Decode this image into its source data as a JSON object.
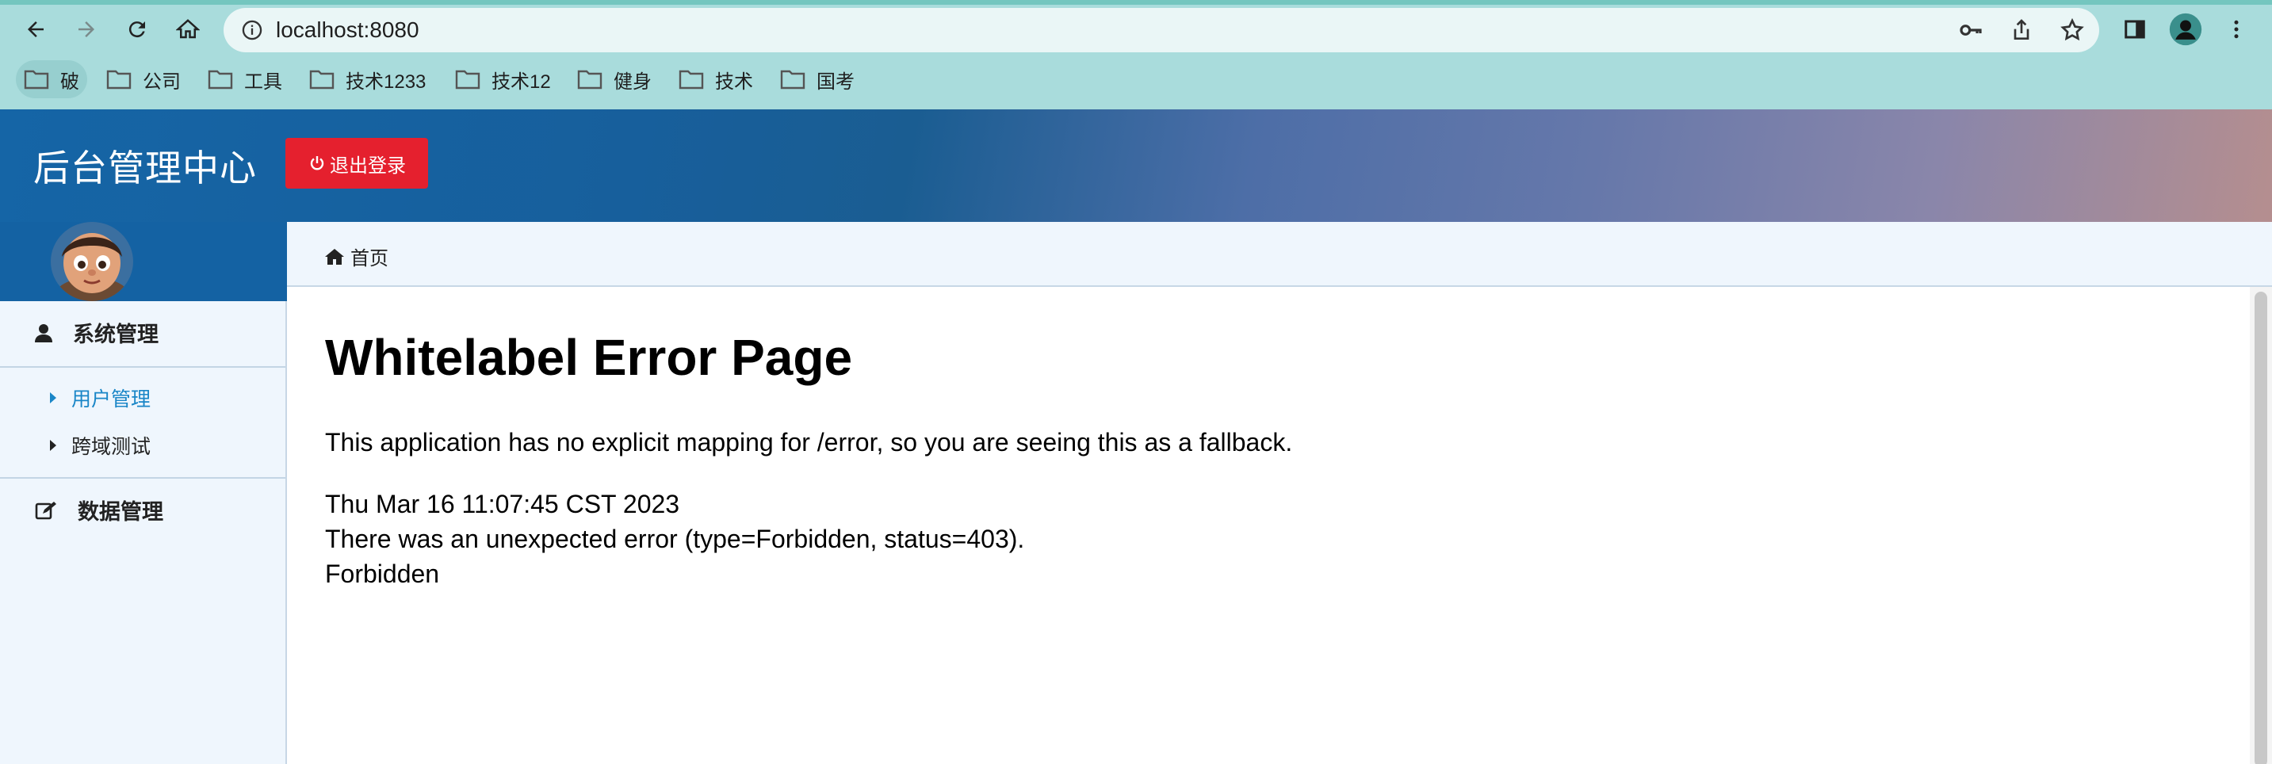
{
  "browser": {
    "url": "localhost:8080",
    "bookmarks": [
      {
        "label": "破",
        "icon": "folder-icon"
      },
      {
        "label": "公司",
        "icon": "folder-icon"
      },
      {
        "label": "工具",
        "icon": "folder-icon"
      },
      {
        "label": "技术1233",
        "icon": "folder-icon"
      },
      {
        "label": "技术12",
        "icon": "folder-icon"
      },
      {
        "label": "健身",
        "icon": "folder-icon"
      },
      {
        "label": "技术",
        "icon": "folder-icon"
      },
      {
        "label": "国考",
        "icon": "folder-icon"
      }
    ],
    "toolbar_icons": [
      "back-arrow-icon",
      "forward-arrow-icon",
      "reload-icon",
      "home-icon",
      "info-icon",
      "key-icon",
      "share-icon",
      "star-icon",
      "side-panel-icon",
      "profile-icon",
      "kebab-menu-icon"
    ]
  },
  "app": {
    "title": "后台管理中心",
    "logout_label": "退出登录",
    "accent_color": "#1462a3",
    "logout_color": "#e5202e"
  },
  "sidebar": {
    "groups": [
      {
        "label": "系统管理",
        "icon": "user-icon",
        "items": [
          {
            "label": "用户管理",
            "active": true
          },
          {
            "label": "跨域测试",
            "active": false
          }
        ]
      },
      {
        "label": "数据管理",
        "icon": "edit-icon",
        "items": []
      }
    ]
  },
  "breadcrumb": {
    "home_label": "首页"
  },
  "error_page": {
    "title": "Whitelabel Error Page",
    "message": "This application has no explicit mapping for /error, so you are seeing this as a fallback.",
    "timestamp": "Thu Mar 16 11:07:45 CST 2023",
    "detail": "There was an unexpected error (type=Forbidden, status=403).",
    "reason": "Forbidden"
  }
}
